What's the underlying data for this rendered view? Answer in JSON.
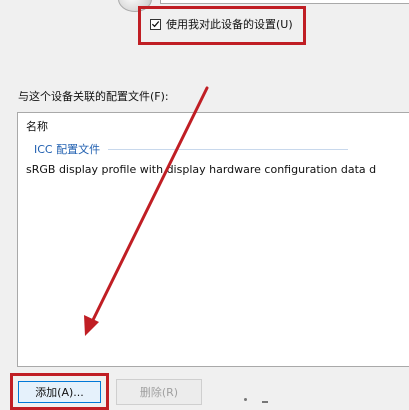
{
  "use_my_settings": {
    "label": "使用我对此设备的设置(U)",
    "checked": true
  },
  "profiles_section": {
    "label": "与这个设备关联的配置文件(F):",
    "column_header": "名称",
    "group_label": "ICC 配置文件",
    "items": [
      "sRGB display profile with display hardware configuration data d"
    ]
  },
  "buttons": {
    "add_label": "添加(A)...",
    "remove_label": "删除(R)"
  },
  "annotation_color": "#c01e24"
}
